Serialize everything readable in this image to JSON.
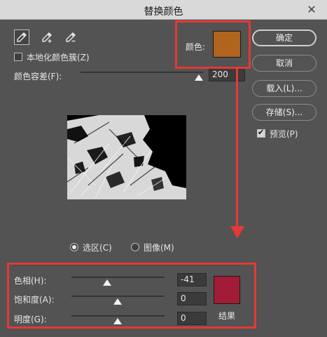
{
  "window": {
    "title": "替换颜色",
    "close_glyph": "✕"
  },
  "tools": [
    {
      "name": "eyedropper",
      "active": true
    },
    {
      "name": "eyedropper-plus",
      "active": false
    },
    {
      "name": "eyedropper-minus",
      "active": false
    }
  ],
  "localized_clusters": {
    "label": "本地化颜色簇(Z)",
    "checked": false
  },
  "color_tolerance": {
    "label": "颜色容差(F):",
    "value": "200"
  },
  "selected_color": {
    "label": "颜色:",
    "color": "#b0641e"
  },
  "buttons": {
    "ok": "确定",
    "cancel": "取消",
    "load": "载入(L)...",
    "save": "存储(S)..."
  },
  "preview": {
    "label": "预览(P)",
    "checked": true
  },
  "view_mode": {
    "selection_label": "选区(C)",
    "image_label": "图像(M)",
    "selected": "selection"
  },
  "replacement": {
    "hue": {
      "label": "色相(H):",
      "value": "-41"
    },
    "saturation": {
      "label": "饱和度(A):",
      "value": "0"
    },
    "lightness": {
      "label": "明度(G):",
      "value": "0"
    },
    "result_label": "结果",
    "result_color": "#a31c37"
  },
  "annotations": {
    "highlight_color": "#e53935"
  }
}
